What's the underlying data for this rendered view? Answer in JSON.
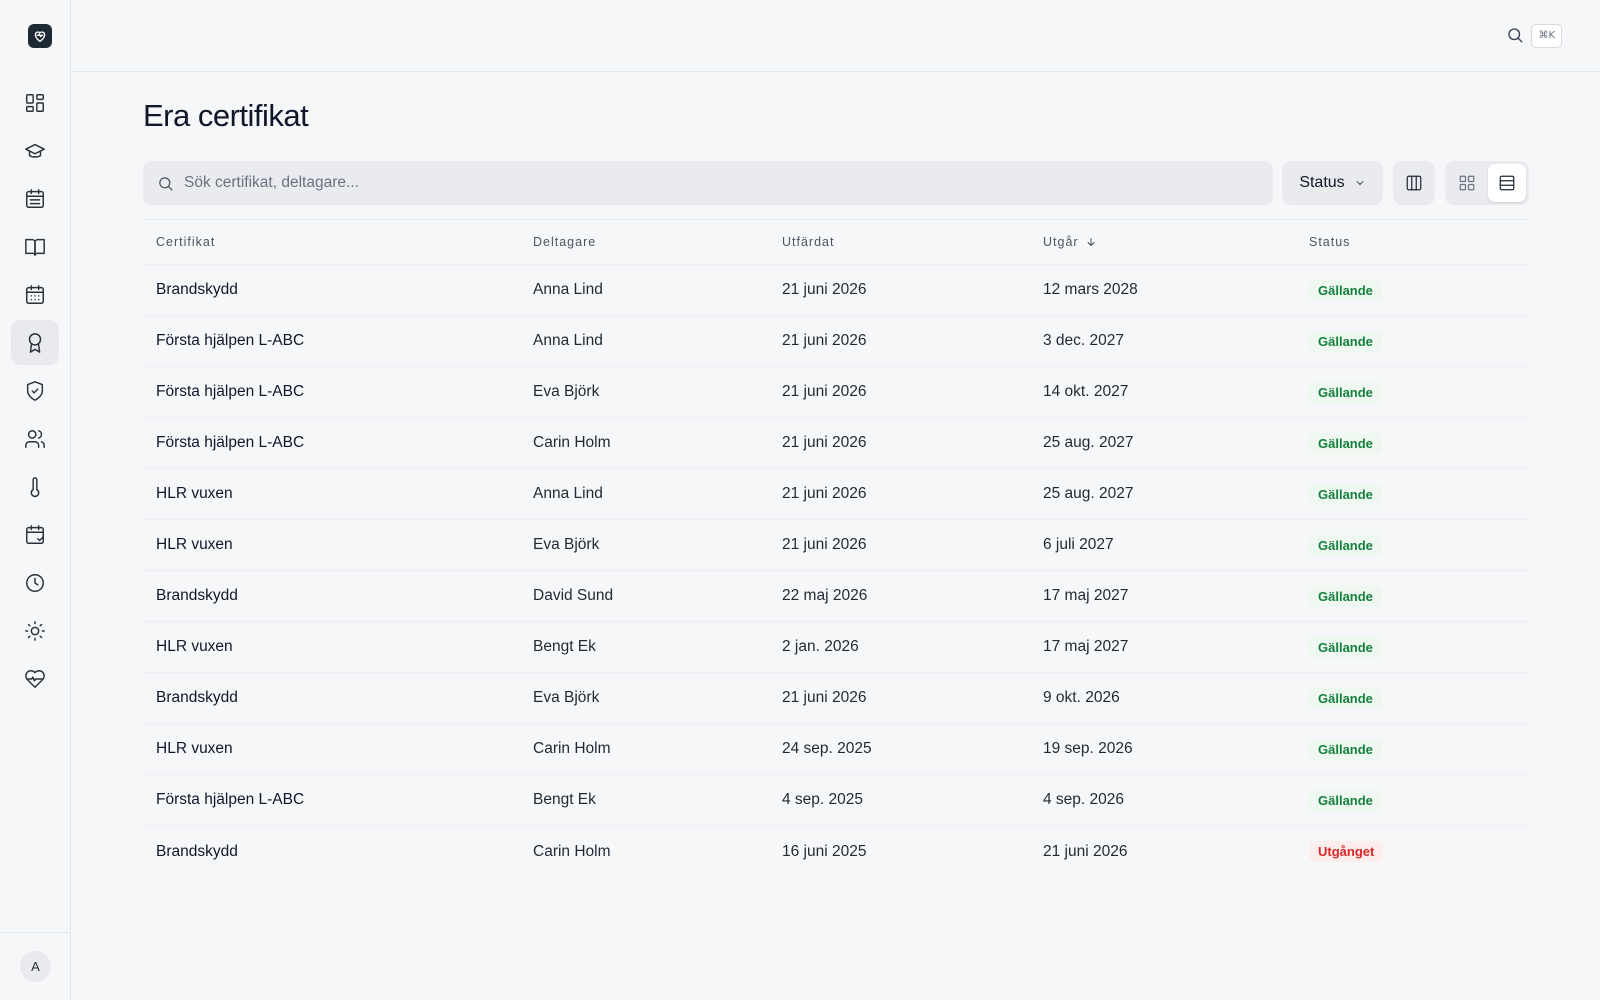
{
  "sidebar": {
    "nav": [
      {
        "icon": "dashboard-icon"
      },
      {
        "icon": "graduation-cap-icon"
      },
      {
        "icon": "calendar-list-icon"
      },
      {
        "icon": "book-icon"
      },
      {
        "icon": "calendar-icon"
      },
      {
        "icon": "award-icon",
        "active": true
      },
      {
        "icon": "shield-check-icon"
      },
      {
        "icon": "users-icon"
      },
      {
        "icon": "thermometer-icon"
      },
      {
        "icon": "calendar-check-icon"
      },
      {
        "icon": "clock-icon"
      },
      {
        "icon": "sun-icon"
      },
      {
        "icon": "heart-pulse-icon"
      }
    ],
    "avatar_initial": "A"
  },
  "topbar": {
    "shortcut": "⌘K"
  },
  "page": {
    "title": "Era certifikat"
  },
  "toolbar": {
    "search_placeholder": "Sök certifikat, deltagare...",
    "status_label": "Status"
  },
  "table": {
    "headers": {
      "certificate": "Certifikat",
      "participant": "Deltagare",
      "issued": "Utfärdat",
      "expires": "Utgår",
      "status": "Status"
    },
    "rows": [
      {
        "certificate": "Brandskydd",
        "participant": "Anna Lind",
        "issued": "21 juni 2026",
        "expires": "12 mars 2028",
        "status": "Gällande",
        "status_type": "valid"
      },
      {
        "certificate": "Första hjälpen L-ABC",
        "participant": "Anna Lind",
        "issued": "21 juni 2026",
        "expires": "3 dec. 2027",
        "status": "Gällande",
        "status_type": "valid"
      },
      {
        "certificate": "Första hjälpen L-ABC",
        "participant": "Eva Björk",
        "issued": "21 juni 2026",
        "expires": "14 okt. 2027",
        "status": "Gällande",
        "status_type": "valid"
      },
      {
        "certificate": "Första hjälpen L-ABC",
        "participant": "Carin Holm",
        "issued": "21 juni 2026",
        "expires": "25 aug. 2027",
        "status": "Gällande",
        "status_type": "valid"
      },
      {
        "certificate": "HLR vuxen",
        "participant": "Anna Lind",
        "issued": "21 juni 2026",
        "expires": "25 aug. 2027",
        "status": "Gällande",
        "status_type": "valid"
      },
      {
        "certificate": "HLR vuxen",
        "participant": "Eva Björk",
        "issued": "21 juni 2026",
        "expires": "6 juli 2027",
        "status": "Gällande",
        "status_type": "valid"
      },
      {
        "certificate": "Brandskydd",
        "participant": "David Sund",
        "issued": "22 maj 2026",
        "expires": "17 maj 2027",
        "status": "Gällande",
        "status_type": "valid"
      },
      {
        "certificate": "HLR vuxen",
        "participant": "Bengt Ek",
        "issued": "2 jan. 2026",
        "expires": "17 maj 2027",
        "status": "Gällande",
        "status_type": "valid"
      },
      {
        "certificate": "Brandskydd",
        "participant": "Eva Björk",
        "issued": "21 juni 2026",
        "expires": "9 okt. 2026",
        "status": "Gällande",
        "status_type": "valid"
      },
      {
        "certificate": "HLR vuxen",
        "participant": "Carin Holm",
        "issued": "24 sep. 2025",
        "expires": "19 sep. 2026",
        "status": "Gällande",
        "status_type": "valid"
      },
      {
        "certificate": "Första hjälpen L-ABC",
        "participant": "Bengt Ek",
        "issued": "4 sep. 2025",
        "expires": "4 sep. 2026",
        "status": "Gällande",
        "status_type": "valid"
      },
      {
        "certificate": "Brandskydd",
        "participant": "Carin Holm",
        "issued": "16 juni 2025",
        "expires": "21 juni 2026",
        "status": "Utgånget",
        "status_type": "expired"
      }
    ]
  },
  "colors": {
    "valid": "#15803d",
    "expired": "#dc2626"
  }
}
